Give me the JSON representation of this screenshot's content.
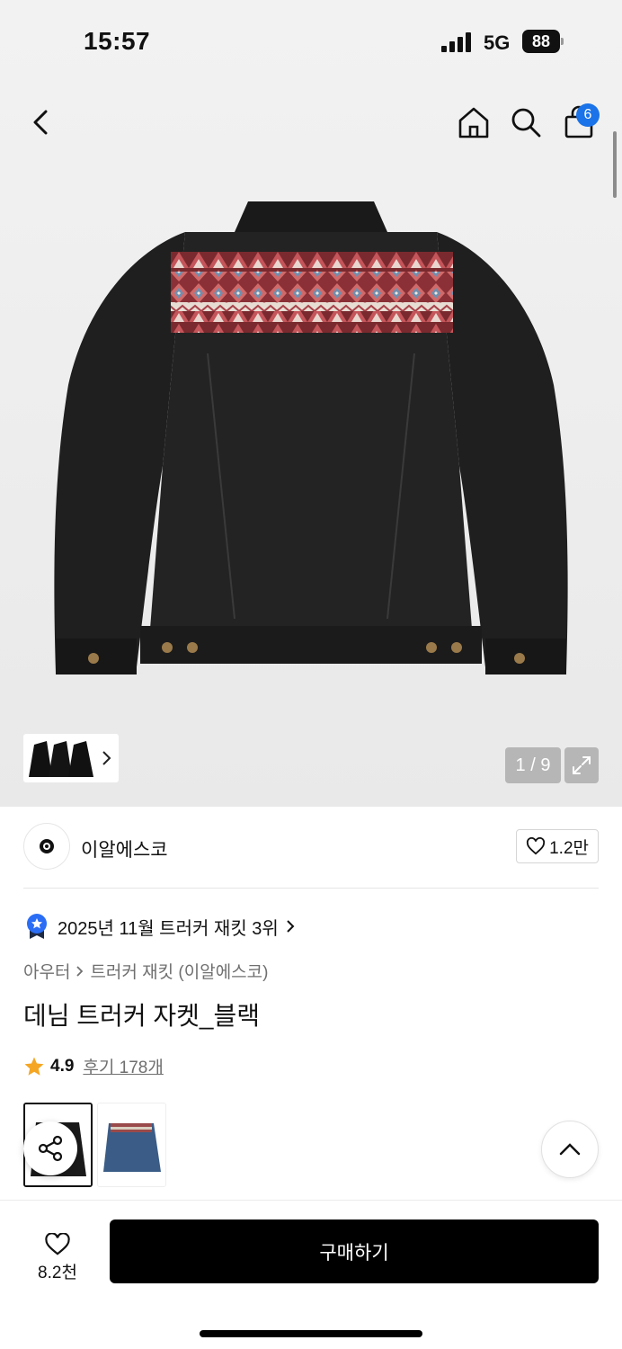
{
  "status_bar": {
    "time": "15:57",
    "network": "5G",
    "battery": "88"
  },
  "nav": {
    "cart_badge": "6"
  },
  "gallery": {
    "counter": "1 / 9"
  },
  "brand": {
    "name": "이알에스코",
    "likes": "1.2만"
  },
  "ranking": {
    "text": "2025년 11월 트러커 재킷 3위"
  },
  "breadcrumb": {
    "category": "아우터",
    "subcategory": "트러커 재킷 (이알에스코)"
  },
  "product": {
    "title": "데님 트러커 자켓_블랙",
    "rating": "4.9",
    "reviews": "후기 178개"
  },
  "bottom": {
    "wish_count": "8.2천",
    "buy_label": "구매하기"
  },
  "colors": {
    "accent": "#1a73e8",
    "star": "#f5a623",
    "primary_button": "#000000"
  }
}
